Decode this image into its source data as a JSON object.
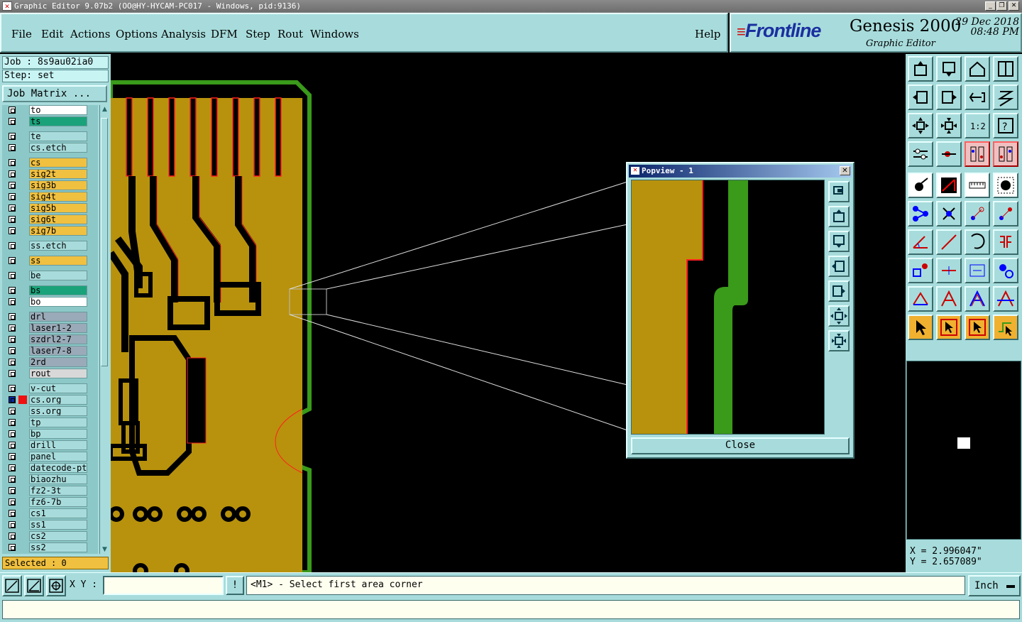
{
  "window": {
    "title": "Graphic Editor 9.07b2 (OO@HY-HYCAM-PC017 - Windows, pid:9136)",
    "icon_name": "app-icon"
  },
  "menu": [
    "File",
    "Edit",
    "Actions",
    "Options",
    "Analysis",
    "DFM",
    "Step",
    "Rout",
    "Windows"
  ],
  "help_label": "Help",
  "brand": {
    "logo": "Frontline",
    "product": "Genesis 2000",
    "subtitle": "Graphic Editor",
    "date": "29 Dec 2018",
    "time": "08:48 PM"
  },
  "job": {
    "job_label": "Job : 8s9au02ia0",
    "step_label": "Step: set",
    "matrix_button": "Job Matrix ..."
  },
  "layers": [
    {
      "name": "to",
      "color": "#ffffff"
    },
    {
      "name": "ts",
      "color": "#1aa37a"
    },
    {
      "name": "te",
      "color": "#a8dcdc"
    },
    {
      "name": "cs.etch",
      "color": "#a8dcdc"
    },
    {
      "name": "cs",
      "color": "#f0c040"
    },
    {
      "name": "sig2t",
      "color": "#f0c040"
    },
    {
      "name": "sig3b",
      "color": "#f0c040"
    },
    {
      "name": "sig4t",
      "color": "#f0c040"
    },
    {
      "name": "sig5b",
      "color": "#f0c040"
    },
    {
      "name": "sig6t",
      "color": "#f0c040"
    },
    {
      "name": "sig7b",
      "color": "#f0c040"
    },
    {
      "name": "ss.etch",
      "color": "#a8dcdc"
    },
    {
      "name": "ss",
      "color": "#f0c040"
    },
    {
      "name": "be",
      "color": "#a8dcdc"
    },
    {
      "name": "bs",
      "color": "#1aa37a"
    },
    {
      "name": "bo",
      "color": "#ffffff"
    },
    {
      "name": "drl",
      "color": "#9aaab8"
    },
    {
      "name": "laser1-2",
      "color": "#9aaab8"
    },
    {
      "name": "szdrl2-7",
      "color": "#9aaab8"
    },
    {
      "name": "laser7-8",
      "color": "#9aaab8"
    },
    {
      "name": "2rd",
      "color": "#9aaab8"
    },
    {
      "name": "rout",
      "color": "#d8d8d8"
    },
    {
      "name": "v-cut",
      "color": "#a8dcdc"
    },
    {
      "name": "cs.org",
      "color": "#a8dcdc"
    },
    {
      "name": "ss.org",
      "color": "#a8dcdc"
    },
    {
      "name": "tp",
      "color": "#a8dcdc"
    },
    {
      "name": "bp",
      "color": "#a8dcdc"
    },
    {
      "name": "drill",
      "color": "#a8dcdc"
    },
    {
      "name": "panel",
      "color": "#a8dcdc"
    },
    {
      "name": "datecode-pt",
      "color": "#a8dcdc"
    },
    {
      "name": "biaozhu",
      "color": "#a8dcdc"
    },
    {
      "name": "fz2-3t",
      "color": "#a8dcdc"
    },
    {
      "name": "fz6-7b",
      "color": "#a8dcdc"
    },
    {
      "name": "cs1",
      "color": "#a8dcdc"
    },
    {
      "name": "ss1",
      "color": "#a8dcdc"
    },
    {
      "name": "cs2",
      "color": "#a8dcdc"
    },
    {
      "name": "ss2",
      "color": "#a8dcdc"
    }
  ],
  "selected_label": "Selected : 0",
  "popview": {
    "title": "Popview - 1",
    "close_label": "Close",
    "tools": [
      "zoom-fit-icon",
      "page-up-icon",
      "page-down-icon",
      "page-left-icon",
      "page-right-icon",
      "zoom-in-icon",
      "zoom-out-icon"
    ]
  },
  "toolbar_icons": [
    "page-up-icon",
    "page-down-icon",
    "home-icon",
    "split-view-icon",
    "page-left-icon",
    "page-right-icon",
    "undo-icon",
    "redraw-icon",
    "zoom-in-icon",
    "zoom-out-icon",
    "scale-1-2-icon",
    "help-icon",
    "settings-icon",
    "snap-icon",
    "layer-compare-icon",
    "layer-compare-alt-icon",
    "add-pad-icon",
    "add-line-icon",
    "ruler-icon",
    "circle-pad-icon",
    "connect-icon",
    "delete-icon",
    "move-icon",
    "copy-icon",
    "angle-icon",
    "line-icon",
    "arc-icon",
    "mirror-icon",
    "resize-icon",
    "break-icon",
    "measure-icon",
    "group-icon",
    "triangle-icon",
    "polygon-icon",
    "outline-icon",
    "contour-icon",
    "select-icon",
    "select-box-icon",
    "select-net-icon",
    "select-route-icon"
  ],
  "coords": {
    "x": "X = 2.996047\"",
    "y": "Y = 2.657089\""
  },
  "status": {
    "xy_label": "X Y :",
    "xy_value": "",
    "bang": "!",
    "prompt": "<M1> - Select first area corner",
    "unit": "Inch"
  },
  "colors": {
    "panel": "#a8dcdc",
    "copper": "#b8920c",
    "outline": "#3a9a1a",
    "edge": "#ff2020"
  }
}
